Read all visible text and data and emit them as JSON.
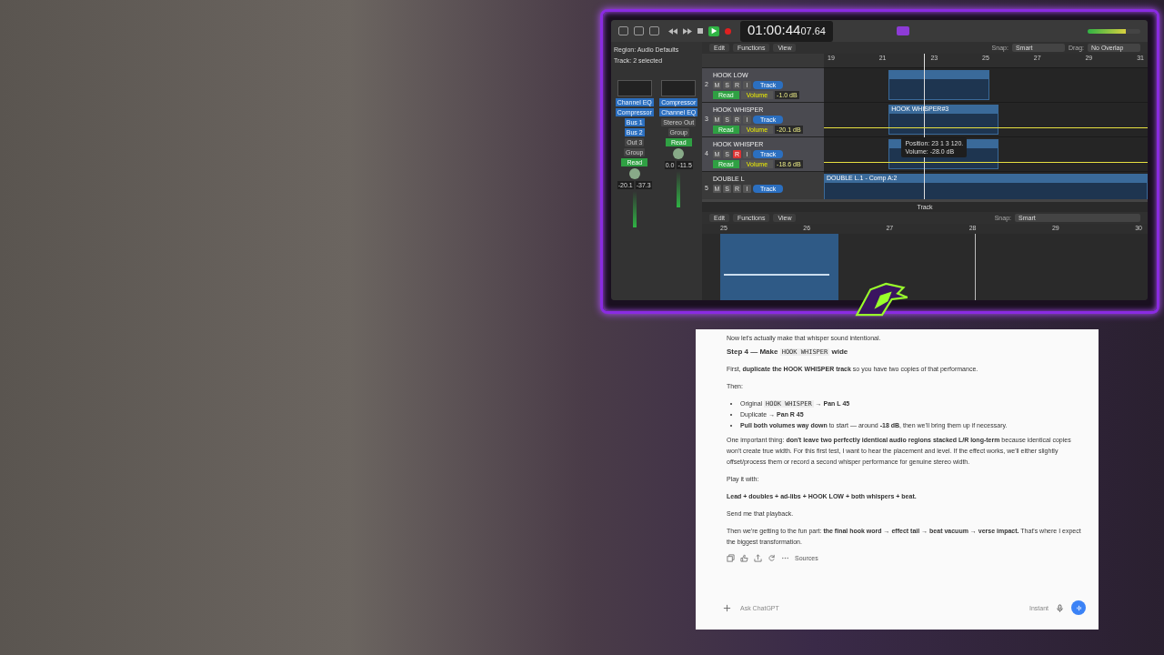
{
  "daw": {
    "transport": {
      "playing": true,
      "time_main": "01:00:44",
      "time_sub": "07.64"
    },
    "master_volume": {
      "level": 0.72
    },
    "inspector": {
      "region": "Region: Audio Defaults",
      "track": "Track: 2 selected",
      "strips": [
        {
          "plugins": [
            "Channel EQ",
            "Compressor"
          ],
          "sends": [
            "Bus 1",
            "Bus 2"
          ],
          "output": "Out 3",
          "group": "Group",
          "automation": "Read",
          "readings": [
            "-20.1",
            "-37.3"
          ]
        },
        {
          "plugins": [
            "Compressor",
            "Channel EQ"
          ],
          "output": "Stereo Out",
          "group": "Group",
          "automation": "Read",
          "readings": [
            "0.0",
            "-11.5"
          ]
        }
      ]
    },
    "toolbar": {
      "menus": [
        "Edit",
        "Functions",
        "View"
      ],
      "snap_label": "Snap:",
      "snap": "Smart",
      "drag_label": "Drag:",
      "drag": "No Overlap"
    },
    "ruler": [
      "19",
      "21",
      "23",
      "25",
      "27",
      "29",
      "31"
    ],
    "tracks": [
      {
        "number": "2",
        "name": "HOOK LOW",
        "selected": true,
        "buttons": [
          {
            "label": "M",
            "on": false
          },
          {
            "label": "S",
            "on": false
          },
          {
            "label": "R",
            "on": false
          },
          {
            "label": "I",
            "on": false
          }
        ],
        "button": "Track",
        "mode": "Read",
        "param": "Volume",
        "value": "-1.0 dB"
      },
      {
        "number": "3",
        "name": "HOOK WHISPER",
        "selected": true,
        "buttons": [
          {
            "label": "M",
            "on": false
          },
          {
            "label": "S",
            "on": false
          },
          {
            "label": "R",
            "on": false
          },
          {
            "label": "I",
            "on": false
          }
        ],
        "button": "Track",
        "mode": "Read",
        "param": "Volume",
        "value": "-20.1 dB",
        "region": "HOOK WHISPER#3"
      },
      {
        "number": "4",
        "name": "HOOK WHISPER",
        "selected": true,
        "buttons": [
          {
            "label": "M",
            "on": false
          },
          {
            "label": "S",
            "on": false
          },
          {
            "label": "R",
            "on": true
          },
          {
            "label": "I",
            "on": false
          }
        ],
        "button": "Track",
        "mode": "Read",
        "param": "Volume",
        "value": "-18.6 dB"
      },
      {
        "number": "5",
        "name": "DOUBLE L",
        "selected": false,
        "buttons": [
          {
            "label": "M",
            "on": false
          },
          {
            "label": "S",
            "on": false
          },
          {
            "label": "R",
            "on": false
          },
          {
            "label": "I",
            "on": false
          }
        ],
        "button": "Track",
        "region": "DOUBLE L.1 - Comp A:2"
      }
    ],
    "tooltip": [
      "Position: 23 1 3 120.",
      "Volume: -28.0 dB"
    ],
    "editor": {
      "title": "Track",
      "menus": [
        "Edit",
        "Functions",
        "View"
      ],
      "snap_label": "Snap:",
      "snap": "Smart",
      "ruler": [
        "25",
        "26",
        "27",
        "28",
        "29",
        "30"
      ]
    }
  },
  "chat": {
    "blocks": [
      {
        "kind": "cut",
        "segments": [
          {
            "kind": "text",
            "text": "Now let's actually make that whisper sound intentional."
          }
        ]
      },
      {
        "kind": "heading",
        "segments": [
          {
            "kind": "text",
            "text": "Step 4 — Make "
          },
          {
            "kind": "code",
            "text": "HOOK WHISPER"
          },
          {
            "kind": "text",
            "text": " wide"
          }
        ]
      },
      {
        "kind": "paragraph",
        "segments": [
          {
            "kind": "text",
            "text": "First, **duplicate the HOOK WHISPER track** so you have two copies of that performance."
          }
        ]
      },
      {
        "kind": "paragraph",
        "segments": [
          {
            "kind": "text",
            "text": "Then:"
          }
        ]
      },
      {
        "kind": "bullet",
        "segments": [
          {
            "kind": "text",
            "text": "Original "
          },
          {
            "kind": "code",
            "text": "HOOK WHISPER"
          },
          {
            "kind": "text",
            "text": " → **Pan L 45**"
          }
        ]
      },
      {
        "kind": "bullet",
        "segments": [
          {
            "kind": "text",
            "text": "Duplicate → **Pan R 45**"
          }
        ]
      },
      {
        "kind": "bullet",
        "segments": [
          {
            "kind": "text",
            "text": "**Pull both volumes way down** to start — around **-18 dB**, then we'll bring them up if necessary."
          }
        ]
      },
      {
        "kind": "paragraph",
        "segments": [
          {
            "kind": "text",
            "text": "One important thing: **don't leave two perfectly identical audio regions stacked L/R long-term** because identical copies won't create true width. For this first test, I want to hear the placement and level. If the effect works, we'll either slightly offset/process them or record a second whisper performance for genuine stereo width."
          }
        ]
      },
      {
        "kind": "paragraph",
        "segments": [
          {
            "kind": "text",
            "text": "Play it with:"
          }
        ]
      },
      {
        "kind": "paragraph",
        "segments": [
          {
            "kind": "text",
            "text": "**Lead + doubles + ad-libs + HOOK LOW + both whispers + beat.**"
          }
        ]
      },
      {
        "kind": "paragraph",
        "segments": [
          {
            "kind": "text",
            "text": "Send me that playback."
          }
        ]
      },
      {
        "kind": "paragraph",
        "segments": [
          {
            "kind": "text",
            "text": "Then we're getting to the fun part: **the final hook word → effect tail → beat vacuum → verse impact.** That's where I expect the biggest transformation."
          }
        ]
      }
    ],
    "sources": "Sources",
    "placeholder": "Ask ChatGPT",
    "mode": "Instant"
  }
}
